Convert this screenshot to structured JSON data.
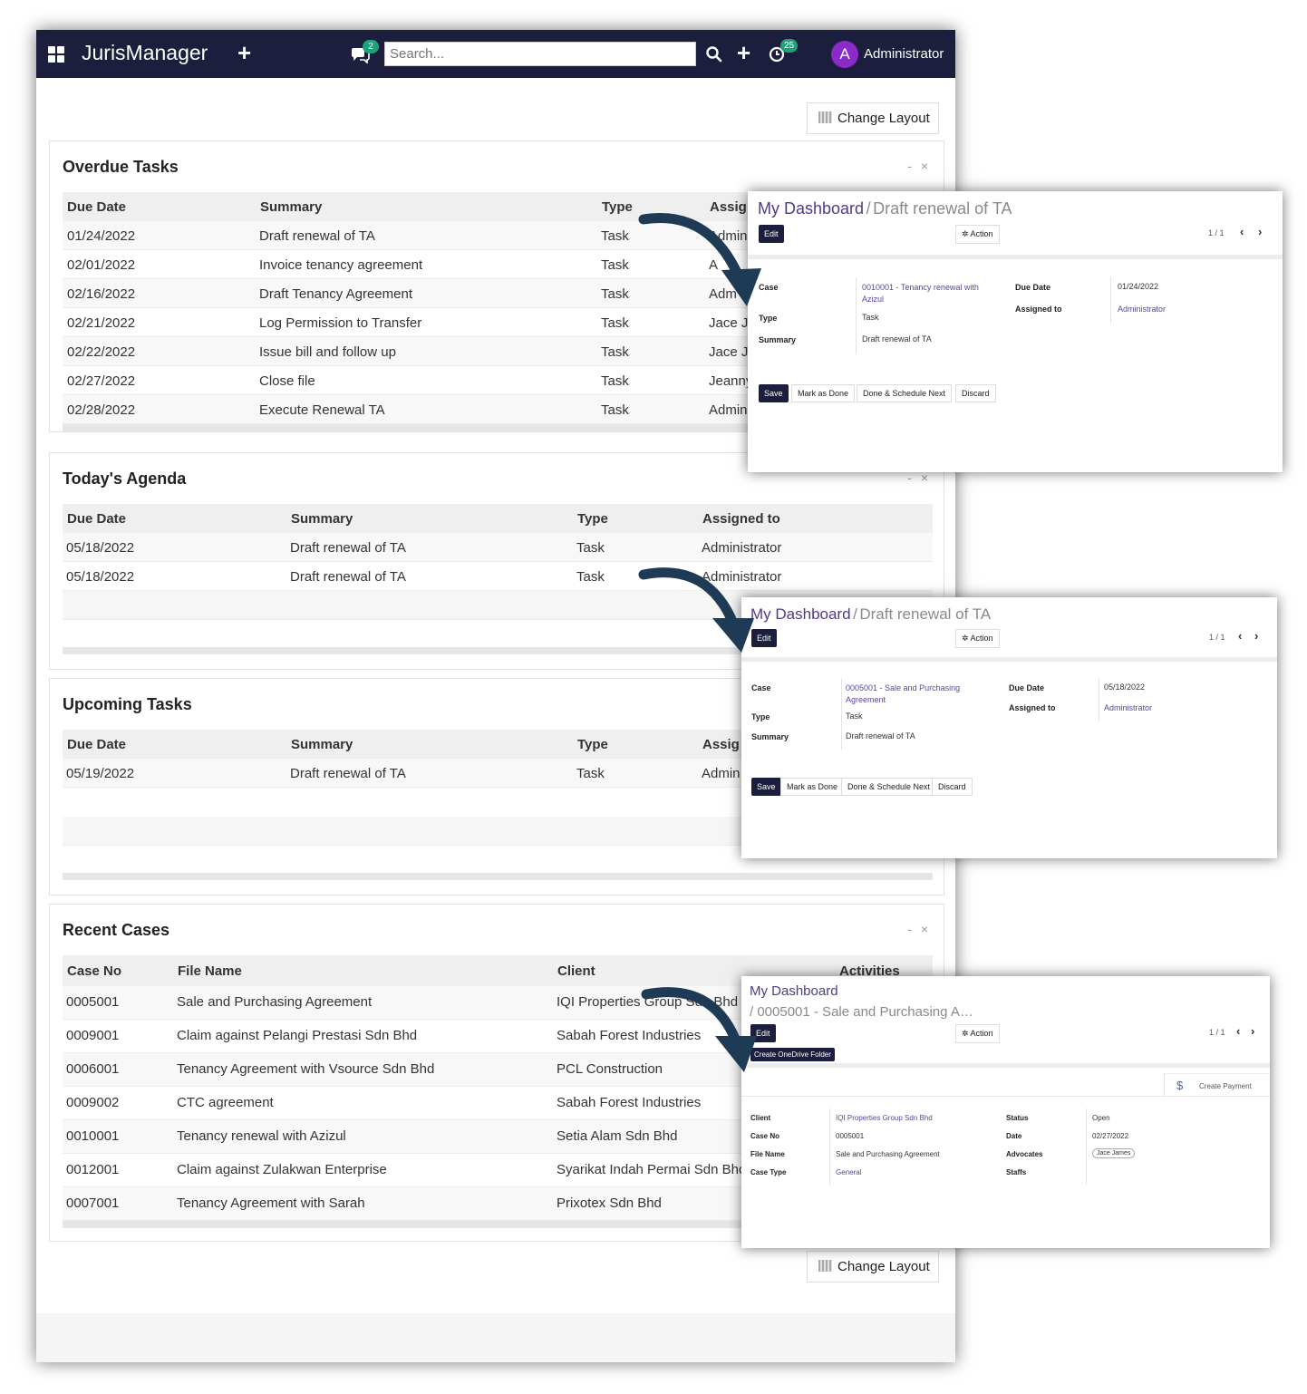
{
  "app": {
    "brand": "JurisManager",
    "search_placeholder": "Search...",
    "messages_count": "2",
    "activities_count": "25",
    "avatar_letter": "A",
    "user_name": "Administrator",
    "change_layout": "Change Layout"
  },
  "overdue": {
    "title": "Overdue Tasks",
    "controls": "- ×",
    "headers": [
      "Due Date",
      "Summary",
      "Type",
      "Assig"
    ],
    "rows": [
      [
        "01/24/2022",
        "Draft renewal of TA",
        "Task",
        "Admini"
      ],
      [
        "02/01/2022",
        "Invoice tenancy agreement",
        "Task",
        "A"
      ],
      [
        "02/16/2022",
        "Draft Tenancy Agreement",
        "Task",
        "Adm"
      ],
      [
        "02/21/2022",
        "Log Permission to Transfer",
        "Task",
        "Jace J"
      ],
      [
        "02/22/2022",
        "Issue bill and follow up",
        "Task",
        "Jace J"
      ],
      [
        "02/27/2022",
        "Close file",
        "Task",
        "Jeanny"
      ],
      [
        "02/28/2022",
        "Execute Renewal TA",
        "Task",
        "Admini"
      ]
    ]
  },
  "agenda": {
    "title": "Today's Agenda",
    "controls": "- ×",
    "headers": [
      "Due Date",
      "Summary",
      "Type",
      "Assigned to"
    ],
    "rows": [
      [
        "05/18/2022",
        "Draft renewal of TA",
        "Task",
        "Administrator"
      ],
      [
        "05/18/2022",
        "Draft renewal of TA",
        "Task",
        "Administrator"
      ]
    ]
  },
  "upcoming": {
    "title": "Upcoming Tasks",
    "headers": [
      "Due Date",
      "Summary",
      "Type",
      "Assig"
    ],
    "rows": [
      [
        "05/19/2022",
        "Draft renewal of TA",
        "Task",
        "Admin"
      ]
    ]
  },
  "recent": {
    "title": "Recent Cases",
    "controls": "- ×",
    "headers": [
      "Case No",
      "File Name",
      "Client",
      "Activities"
    ],
    "rows": [
      [
        "0005001",
        "Sale and Purchasing Agreement",
        "IQI Properties Group Sdn Bhd"
      ],
      [
        "0009001",
        "Claim against Pelangi Prestasi Sdn Bhd",
        "Sabah Forest Industries"
      ],
      [
        "0006001",
        "Tenancy Agreement with Vsource Sdn Bhd",
        "PCL Construction"
      ],
      [
        "0009002",
        "CTC agreement",
        "Sabah Forest Industries"
      ],
      [
        "0010001",
        "Tenancy renewal with Azizul",
        "Setia Alam Sdn Bhd"
      ],
      [
        "0012001",
        "Claim against Zulakwan Enterprise",
        "Syarikat Indah Permai Sdn Bhd"
      ],
      [
        "0007001",
        "Tenancy Agreement with Sarah",
        "Prixotex Sdn Bhd"
      ]
    ]
  },
  "popup1": {
    "crumb": "My Dashboard",
    "slash": "/",
    "current": "Draft renewal of TA",
    "edit": "Edit",
    "action": "✲ Action",
    "pager": "1 / 1",
    "case_label": "Case",
    "case_value": "0010001 - Tenancy renewal with Azizul",
    "type_label": "Type",
    "type_value": "Task",
    "summary_label": "Summary",
    "summary_value": "Draft renewal of TA",
    "due_label": "Due Date",
    "due_value": "01/24/2022",
    "assigned_label": "Assigned to",
    "assigned_value": "Administrator",
    "save": "Save",
    "mark_done": "Mark as Done",
    "done_next": "Done & Schedule Next",
    "discard": "Discard"
  },
  "popup2": {
    "crumb": "My Dashboard",
    "slash": "/",
    "current": "Draft renewal of TA",
    "edit": "Edit",
    "action": "✲ Action",
    "pager": "1 / 1",
    "case_label": "Case",
    "case_value": "0005001 - Sale and Purchasing Agreement",
    "type_label": "Type",
    "type_value": "Task",
    "summary_label": "Summary",
    "summary_value": "Draft renewal of TA",
    "due_label": "Due Date",
    "due_value": "05/18/2022",
    "assigned_label": "Assigned to",
    "assigned_value": "Administrator",
    "save": "Save",
    "mark_done": "Mark as Done",
    "done_next": "Done & Schedule Next",
    "discard": "Discard"
  },
  "popup3": {
    "crumb": "My Dashboard",
    "current": "/ 0005001 - Sale and Purchasing A…",
    "edit": "Edit",
    "action": "✲ Action",
    "pager": "1 / 1",
    "onedrive": "Create OneDrive Folder",
    "create_payment": "Create Payment",
    "client_label": "Client",
    "client_value": "IQI Properties Group Sdn Bhd",
    "caseno_label": "Case No",
    "caseno_value": "0005001",
    "filename_label": "File Name",
    "filename_value": "Sale and Purchasing Agreement",
    "casetype_label": "Case Type",
    "casetype_value": "General",
    "status_label": "Status",
    "status_value": "Open",
    "date_label": "Date",
    "date_value": "02/27/2022",
    "advocates_label": "Advocates",
    "advocates_value": "Jace James",
    "staffs_label": "Staffs"
  },
  "colors": {
    "topbar": "#1b1e3c",
    "badge": "#21a07c",
    "avatar": "#8a2bc9",
    "link": "#4f3b86",
    "arrow": "#1f3a55"
  }
}
